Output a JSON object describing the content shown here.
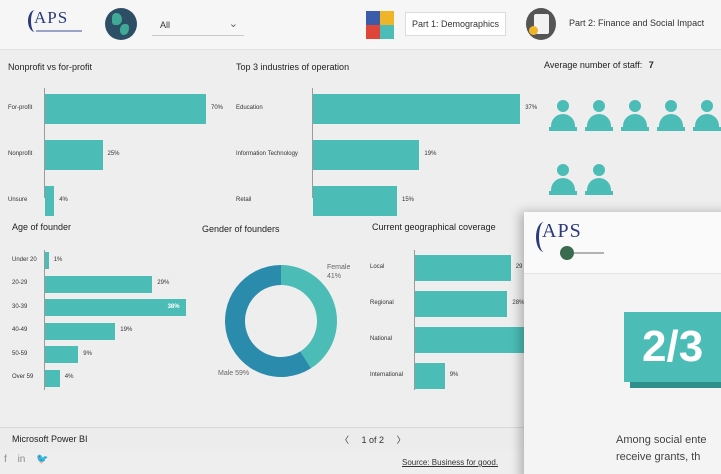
{
  "header": {
    "logo_text": "APS",
    "slicer_value": "All",
    "part1_label": "Part 1: Demographics",
    "part2_label": "Part 2: Finance and Social Impact"
  },
  "panels": {
    "nonprofit": {
      "title": "Nonprofit vs for-profit",
      "items": [
        {
          "label": "For-profit",
          "value": "70%"
        },
        {
          "label": "Nonprofit",
          "value": "25%"
        },
        {
          "label": "Unsure",
          "value": "4%"
        }
      ]
    },
    "industries": {
      "title": "Top 3 industries of operation",
      "items": [
        {
          "label": "Education",
          "value": "37%"
        },
        {
          "label": "Information Technology",
          "value": "19%"
        },
        {
          "label": "Retail",
          "value": "15%"
        }
      ]
    },
    "staff": {
      "title": "Average number of staff:",
      "value": "7"
    },
    "age": {
      "title": "Age of founder",
      "items": [
        {
          "label": "Under 20",
          "value": "1%"
        },
        {
          "label": "20-29",
          "value": "29%"
        },
        {
          "label": "30-39",
          "value": "38%"
        },
        {
          "label": "40-49",
          "value": "19%"
        },
        {
          "label": "50-59",
          "value": "9%"
        },
        {
          "label": "Over 59",
          "value": "4%"
        }
      ]
    },
    "gender": {
      "title": "Gender of founders",
      "female_label": "Female",
      "female_value": "41%",
      "male_label": "Male 59%"
    },
    "geo": {
      "title": "Current geographical coverage",
      "items": [
        {
          "label": "Local",
          "value": "29"
        },
        {
          "label": "Regional",
          "value": "28%"
        },
        {
          "label": "National",
          "value": ""
        },
        {
          "label": "International",
          "value": "9%"
        }
      ]
    }
  },
  "chart_data": [
    {
      "type": "bar",
      "title": "Nonprofit vs for-profit",
      "categories": [
        "For-profit",
        "Nonprofit",
        "Unsure"
      ],
      "values": [
        70,
        25,
        4
      ]
    },
    {
      "type": "bar",
      "title": "Top 3 industries of operation",
      "categories": [
        "Education",
        "Information Technology",
        "Retail"
      ],
      "values": [
        37,
        19,
        15
      ]
    },
    {
      "type": "bar",
      "title": "Age of founder",
      "categories": [
        "Under 20",
        "20-29",
        "30-39",
        "40-49",
        "50-59",
        "Over 59"
      ],
      "values": [
        1,
        29,
        38,
        19,
        9,
        4
      ]
    },
    {
      "type": "pie",
      "title": "Gender of founders",
      "categories": [
        "Female",
        "Male"
      ],
      "values": [
        41,
        59
      ]
    },
    {
      "type": "bar",
      "title": "Current geographical coverage",
      "categories": [
        "Local",
        "Regional",
        "National",
        "International"
      ],
      "values": [
        29,
        28,
        null,
        9
      ]
    }
  ],
  "footer": {
    "app_name": "Microsoft Power BI",
    "pager_prev": "〈",
    "pager_text": "1 of 2",
    "pager_next": "〉",
    "social_f": "f",
    "social_in": "in",
    "social_tw": "🐦",
    "source": "Source: Business for good."
  },
  "overlay": {
    "logo_text": "APS",
    "stat": "2/3",
    "line1": "Among social ente",
    "line2": "receive grants, th"
  },
  "colors": {
    "accent": "#4bbdb6",
    "donut_dark": "#2b8bad"
  }
}
